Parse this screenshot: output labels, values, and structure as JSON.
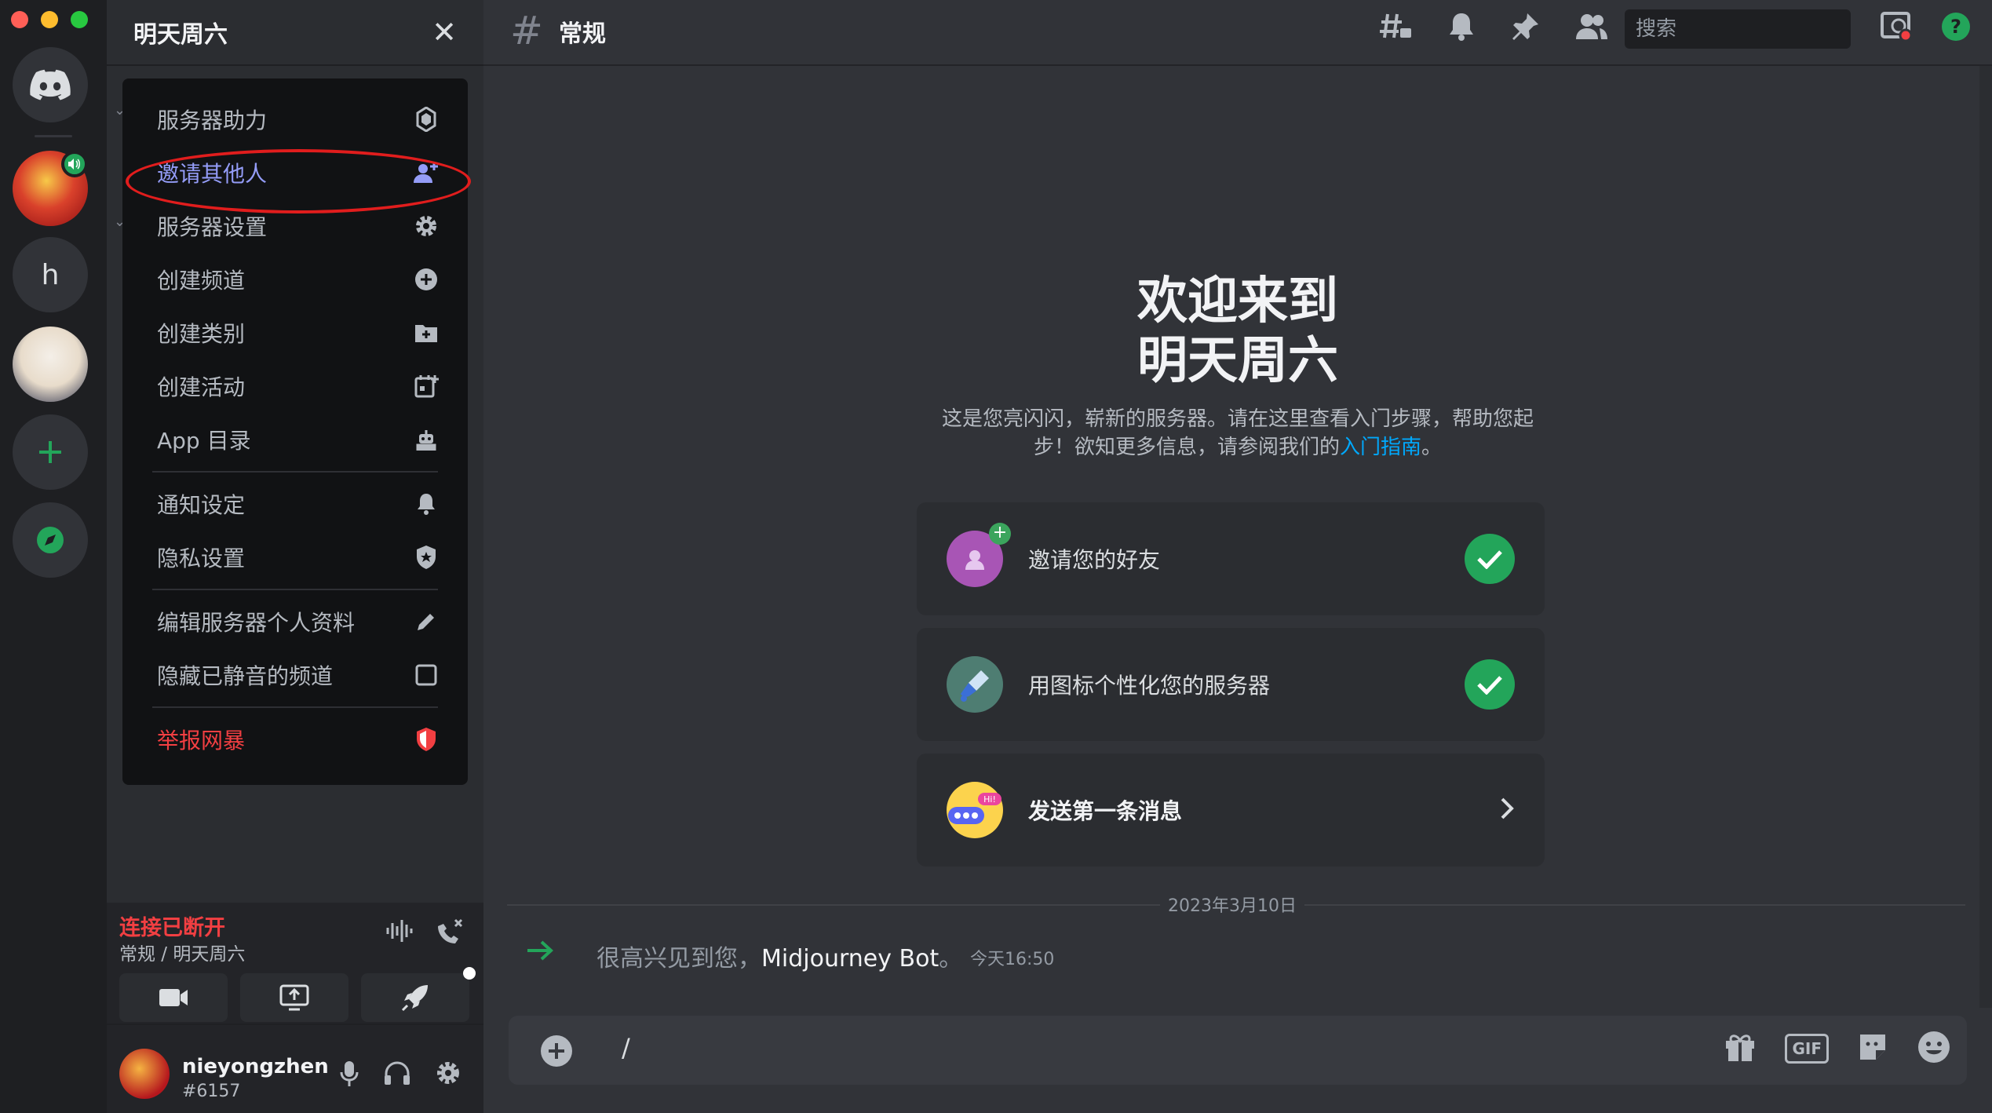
{
  "server": {
    "name": "明天周六"
  },
  "rail": {
    "dm_label": "Direct Messages",
    "server_h": "h"
  },
  "menu": {
    "items": [
      {
        "label": "服务器助力",
        "icon": "boost-icon"
      },
      {
        "label": "邀请其他人",
        "icon": "add-person-icon"
      },
      {
        "label": "服务器设置",
        "icon": "gear-icon"
      },
      {
        "label": "创建频道",
        "icon": "plus-circle-icon"
      },
      {
        "label": "创建类别",
        "icon": "folder-plus-icon"
      },
      {
        "label": "创建活动",
        "icon": "calendar-plus-icon"
      },
      {
        "label": "App 目录",
        "icon": "robot-icon"
      },
      {
        "label": "通知设定",
        "icon": "bell-icon"
      },
      {
        "label": "隐私设置",
        "icon": "shield-icon"
      },
      {
        "label": "编辑服务器个人资料",
        "icon": "pencil-icon"
      },
      {
        "label": "隐藏已静音的频道",
        "icon": "checkbox-icon"
      },
      {
        "label": "举报网暴",
        "icon": "shield-alert-icon"
      }
    ]
  },
  "voice": {
    "status": "连接已断开",
    "channel": "常规 / 明天周六"
  },
  "user": {
    "name": "nieyongzhen",
    "tag": "#6157"
  },
  "channel": {
    "name": "常规"
  },
  "search": {
    "placeholder": "搜索"
  },
  "welcome": {
    "title_line1": "欢迎来到",
    "title_line2": "明天周六",
    "desc_before": "这是您亮闪闪，崭新的服务器。请在这里查看入门步骤，帮助您起步！欲知更多信息，请参阅我们的",
    "link": "入门指南",
    "desc_after": "。"
  },
  "cards": [
    {
      "label": "邀请您的好友",
      "done": true
    },
    {
      "label": "用图标个性化您的服务器",
      "done": true
    },
    {
      "label": "发送第一条消息",
      "done": false
    }
  ],
  "divider_date": "2023年3月10日",
  "join": {
    "prefix": "很高兴见到您，",
    "name": "Midjourney Bot",
    "suffix": "。",
    "time": "今天16:50"
  },
  "composer": {
    "value": "/"
  },
  "colors": {
    "accent": "#5865f2",
    "green": "#23a55a",
    "danger": "#f23f42",
    "link": "#00a8fc"
  }
}
